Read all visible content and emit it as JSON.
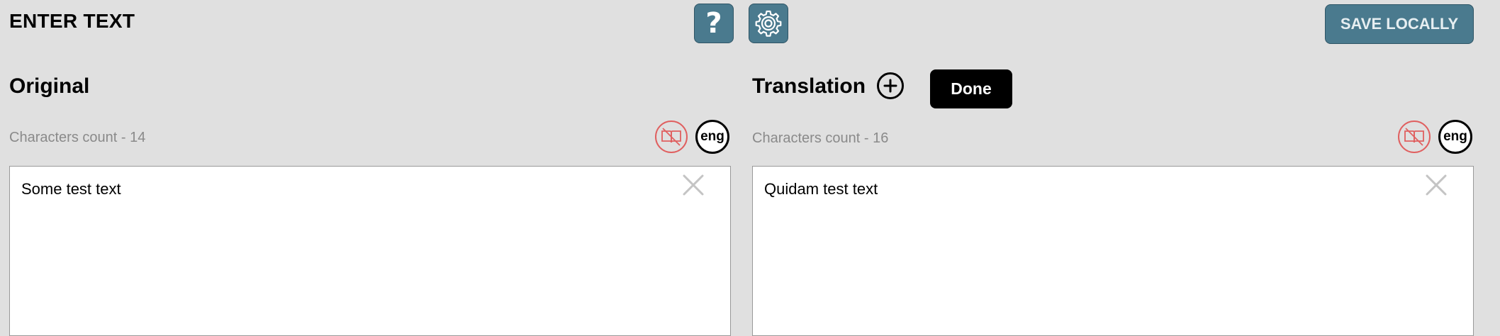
{
  "header": {
    "title": "ENTER TEXT",
    "help_label": "?",
    "save_label": "SAVE LOCALLY"
  },
  "original": {
    "heading": "Original",
    "char_count": "Characters count - 14",
    "lang": "eng",
    "text": "Some test text"
  },
  "translation": {
    "heading": "Translation",
    "done_label": "Done",
    "char_count": "Characters count - 16",
    "lang": "eng",
    "text": "Quidam test text"
  },
  "icons": {
    "help": "question-mark-icon",
    "settings": "gear-icon",
    "add": "plus-circle-icon",
    "dictionary": "dictionary-disabled-icon",
    "clear": "close-icon"
  },
  "colors": {
    "background": "#e0e0e0",
    "accent": "#4a7a8e",
    "dict_disabled": "#e06060"
  }
}
